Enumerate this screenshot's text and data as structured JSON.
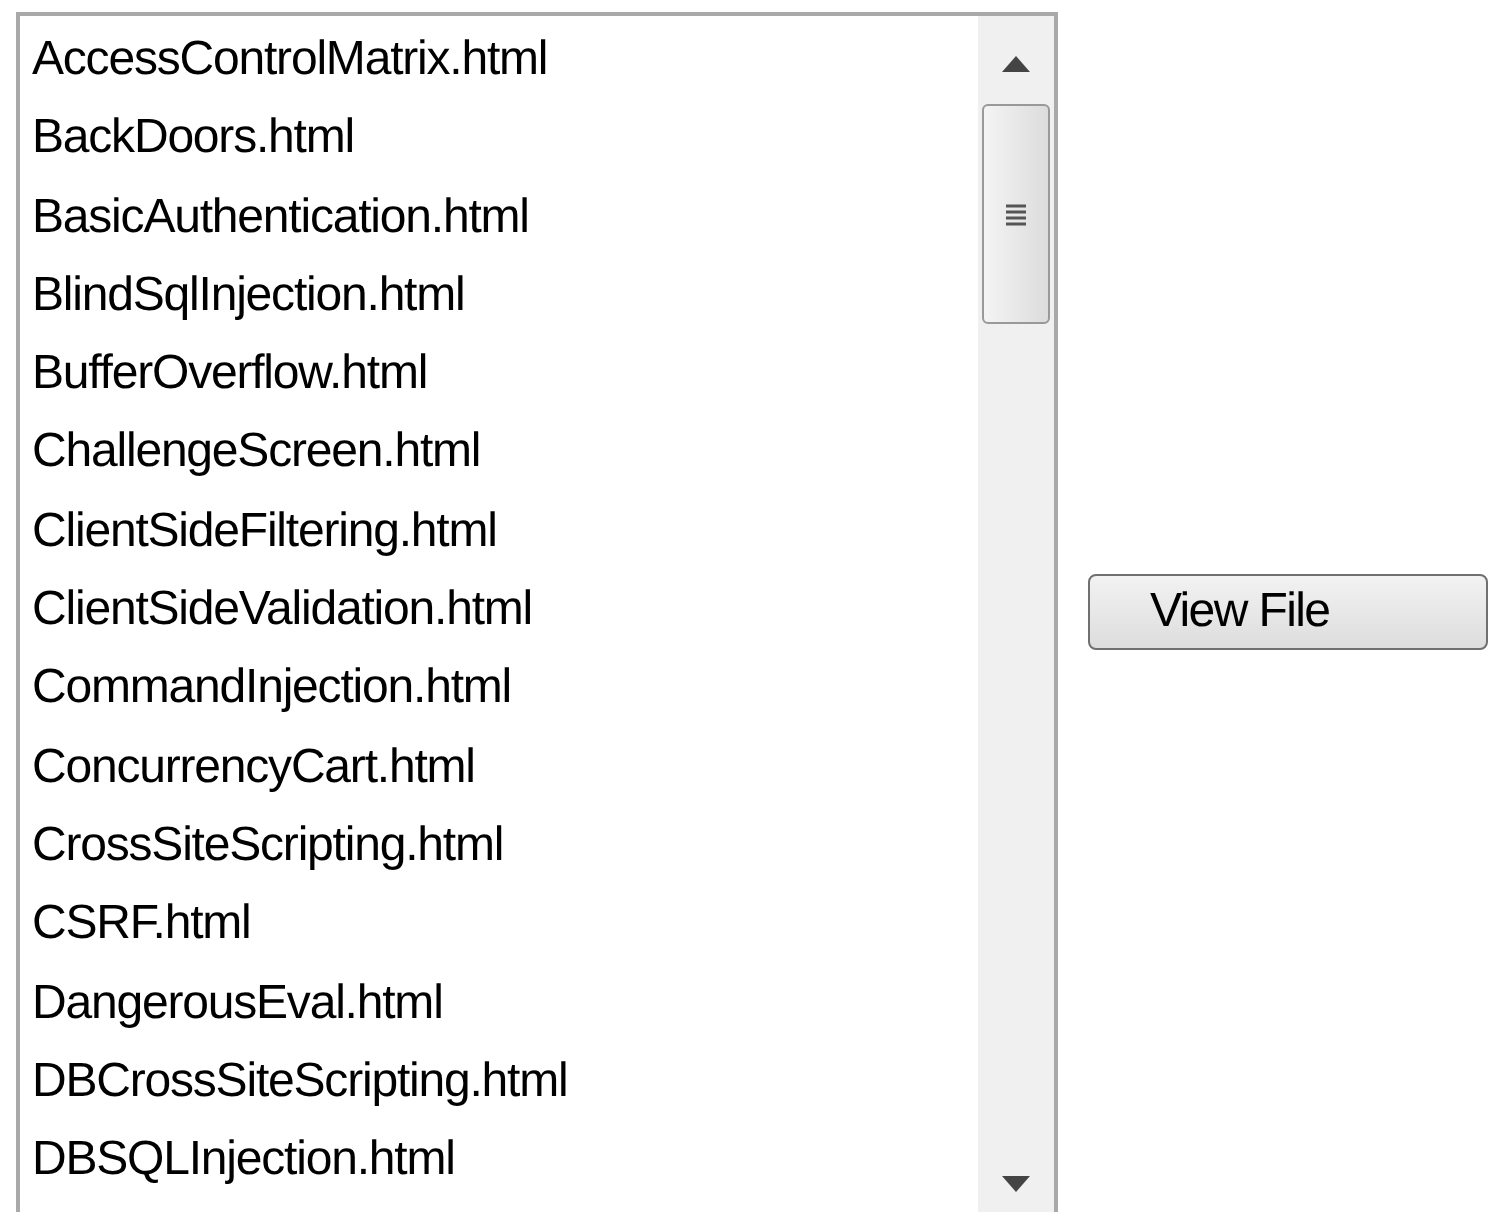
{
  "file_list": {
    "items": [
      "AccessControlMatrix.html",
      "BackDoors.html",
      "BasicAuthentication.html",
      "BlindSqlInjection.html",
      "BufferOverflow.html",
      "ChallengeScreen.html",
      "ClientSideFiltering.html",
      "ClientSideValidation.html",
      "CommandInjection.html",
      "ConcurrencyCart.html",
      "CrossSiteScripting.html",
      "CSRF.html",
      "DangerousEval.html",
      "DBCrossSiteScripting.html",
      "DBSQLInjection.html"
    ]
  },
  "button": {
    "label": "View File"
  }
}
